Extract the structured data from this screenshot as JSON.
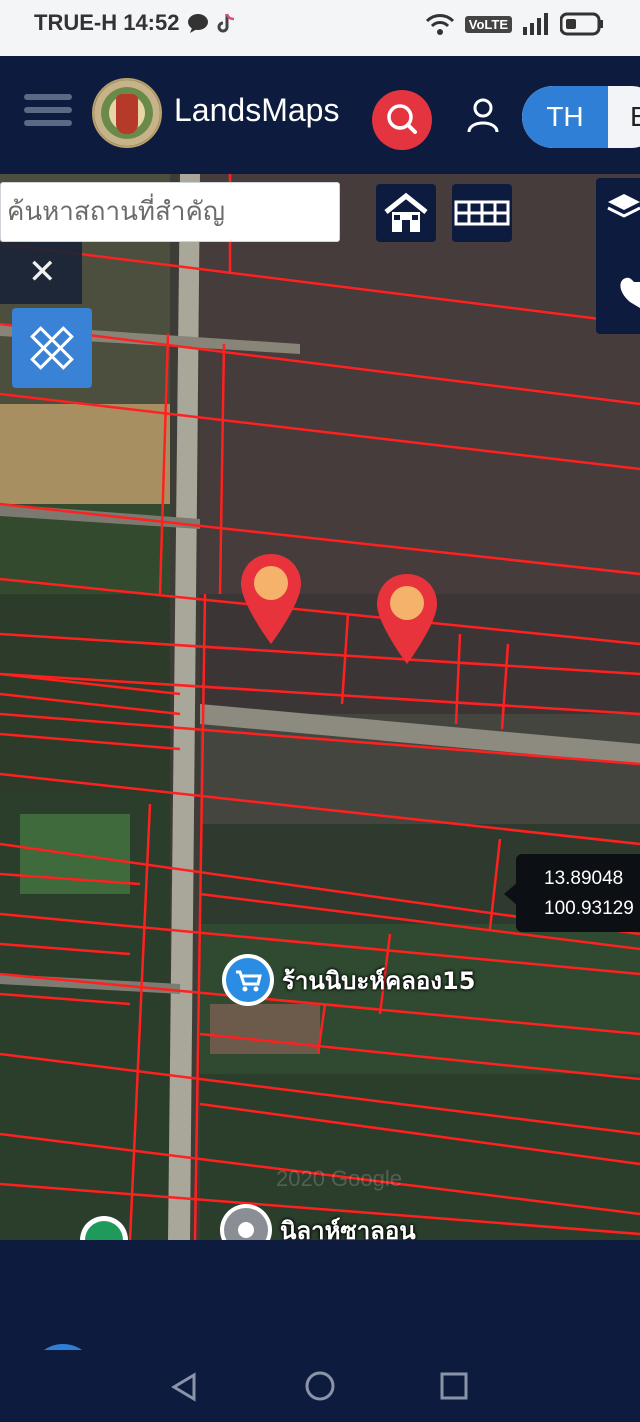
{
  "status_bar": {
    "carrier_time": "TRUE-H 14:52",
    "volte": "VoLTE",
    "icons": [
      "chat-icon",
      "tiktok-icon",
      "wifi-icon",
      "signal-icon",
      "battery-icon"
    ]
  },
  "header": {
    "app_name": "LandsMaps",
    "lang_selected": "TH",
    "lang_other": "E",
    "accent_color": "#2f7fd6",
    "search_button_color": "#e3343f"
  },
  "map": {
    "search_placeholder": "ค้นหาสถานที่สำคัญ",
    "coordinates": {
      "lat": "13.89048",
      "lon": "100.93129"
    },
    "pois": [
      {
        "label": "ร้านนิบะห์คลอง15",
        "icon": "shopping-cart-icon"
      },
      {
        "label": "นิลาห์ซาลอน",
        "icon": "place-icon"
      }
    ],
    "watermark": "2020 Google",
    "parcel_line_color": "#ff2020",
    "marker_color": "#e8333d"
  },
  "nav": {
    "icons": [
      "back-icon",
      "home-circle-icon",
      "recent-apps-icon"
    ]
  }
}
